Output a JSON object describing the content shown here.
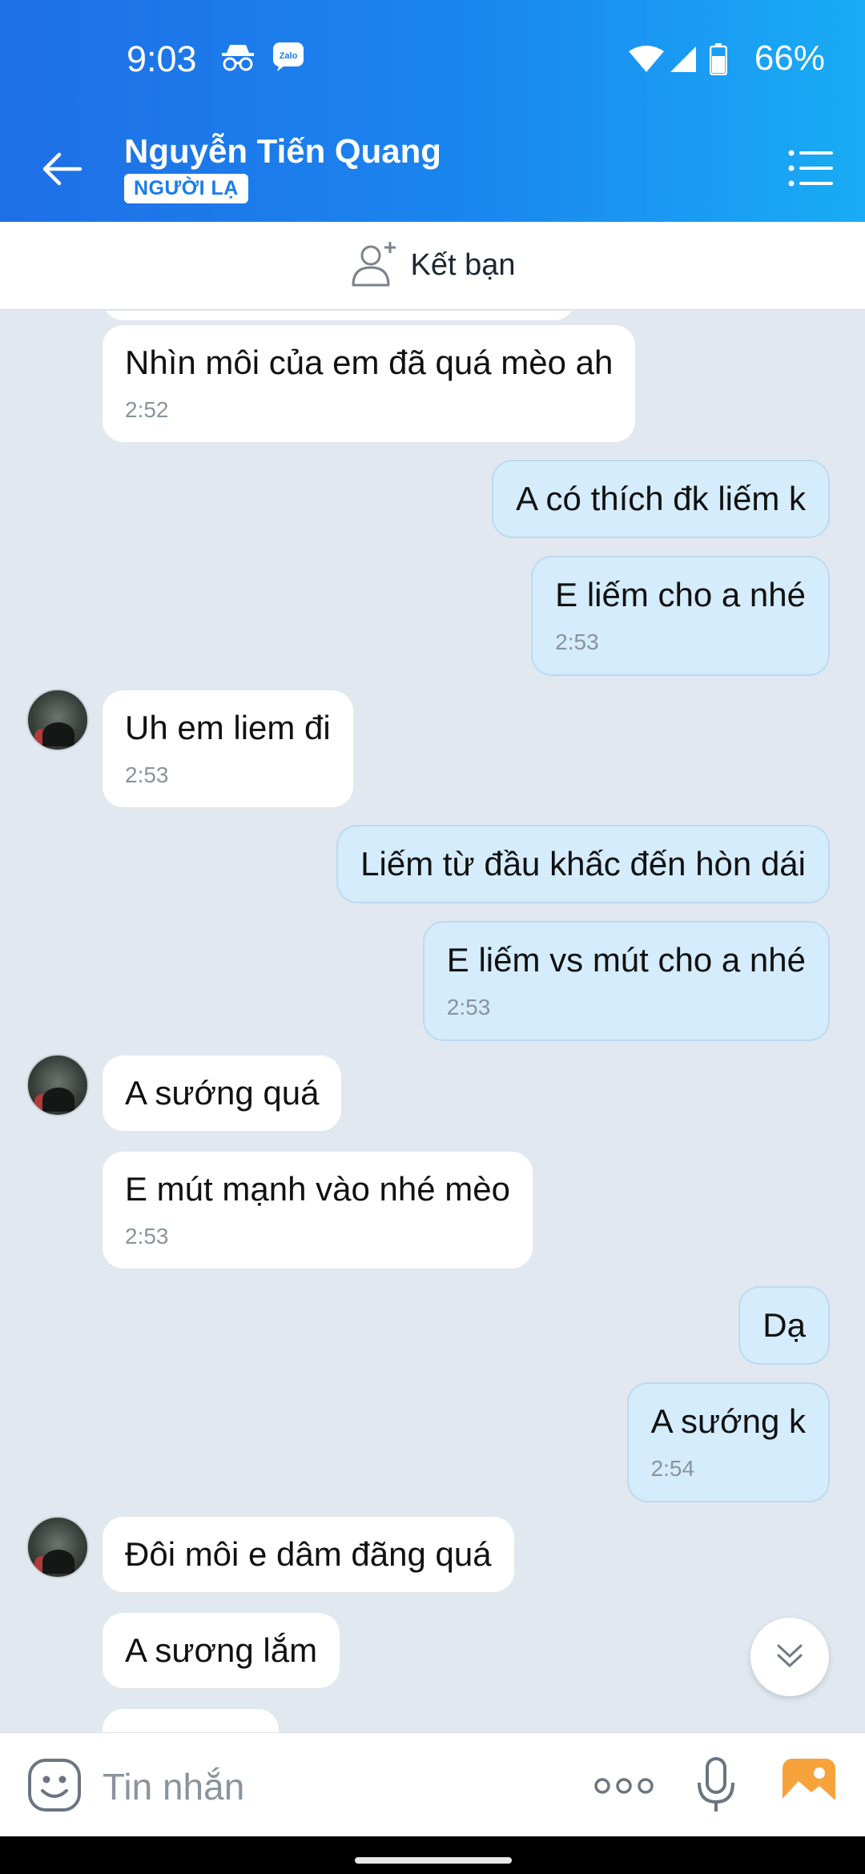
{
  "status_bar": {
    "time": "9:03",
    "battery": "66%"
  },
  "header": {
    "name": "Nguyễn Tiến Quang",
    "badge": "NGƯỜI LẠ"
  },
  "friend_bar": {
    "label": "Kết bạn"
  },
  "messages": [
    {
      "dir": "in",
      "text": "Nhìn môi của em đã quá mèo ah",
      "time": "2:52"
    },
    {
      "dir": "out",
      "text": "A có thích đk liếm k"
    },
    {
      "dir": "out",
      "text": "E liếm cho a nhé",
      "time": "2:53"
    },
    {
      "dir": "in",
      "text": "Uh em liem đi",
      "time": "2:53"
    },
    {
      "dir": "out",
      "text": "Liếm từ đầu khấc đến hòn dái"
    },
    {
      "dir": "out",
      "text": "E liếm vs mút cho a nhé",
      "time": "2:53"
    },
    {
      "dir": "in",
      "text": "A sướng quá"
    },
    {
      "dir": "in",
      "text": "E mút mạnh vào nhé mèo",
      "time": "2:53"
    },
    {
      "dir": "out",
      "text": "Dạ"
    },
    {
      "dir": "out",
      "text": "A sướng k",
      "time": "2:54"
    },
    {
      "dir": "in",
      "text": "Đôi môi e dâm đãng quá"
    },
    {
      "dir": "in",
      "text": "A sương lắm"
    }
  ],
  "composer": {
    "placeholder": "Tin nhắn"
  },
  "colors": {
    "header_start": "#1f6fe6",
    "header_end": "#19acf5",
    "out_bubble": "#d4ecfb",
    "background": "#e2e8f0"
  },
  "icons": [
    "incognito-icon",
    "zalo-icon",
    "wifi-icon",
    "signal-icon",
    "battery-icon",
    "back-arrow-icon",
    "menu-list-icon",
    "add-friend-icon",
    "chevron-down-icon",
    "emoji-icon",
    "more-dots-icon",
    "mic-icon",
    "gallery-icon"
  ]
}
